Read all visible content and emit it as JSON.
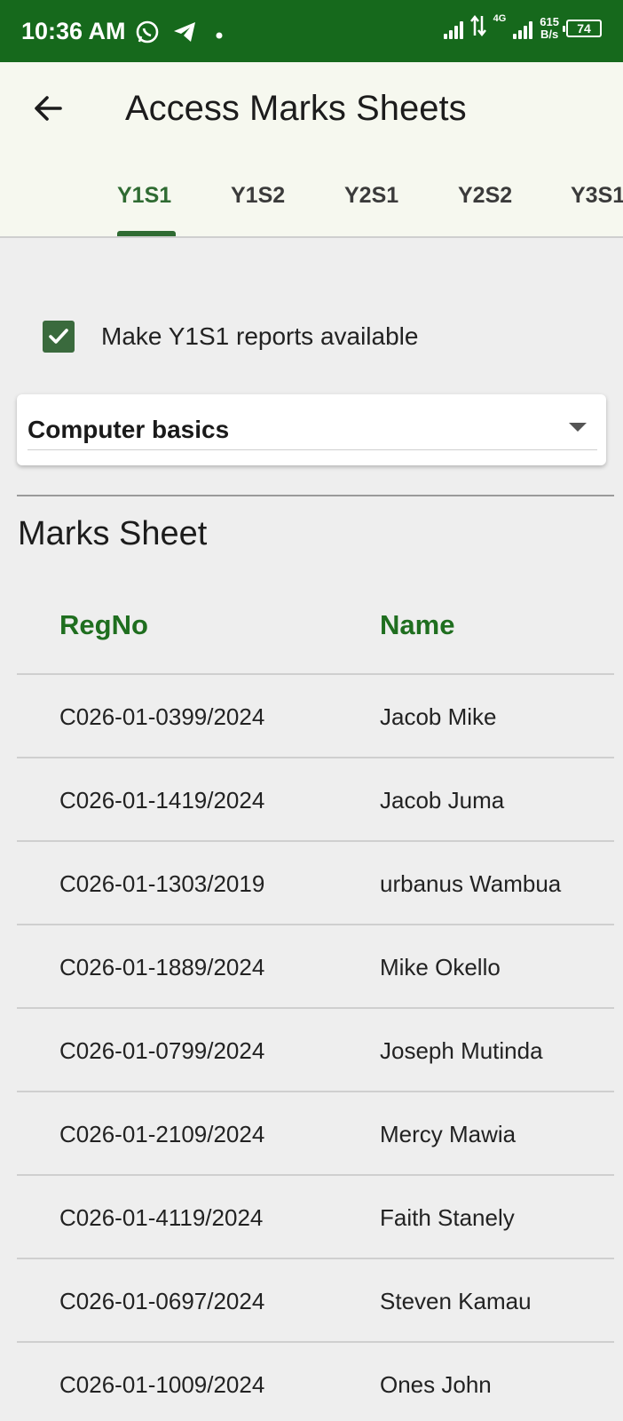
{
  "status_bar": {
    "time": "10:36 AM",
    "network_type": "4G",
    "speed_value": "615",
    "speed_unit": "B/s",
    "battery": "74"
  },
  "app_bar": {
    "title": "Access Marks Sheets",
    "back_icon": "arrow-back-icon"
  },
  "tabs": [
    {
      "label": "Y1S1",
      "active": true
    },
    {
      "label": "Y1S2",
      "active": false
    },
    {
      "label": "Y2S1",
      "active": false
    },
    {
      "label": "Y2S2",
      "active": false
    },
    {
      "label": "Y3S1",
      "active": false
    }
  ],
  "availability": {
    "label": "Make Y1S1 reports available",
    "checked": true
  },
  "course_select": {
    "value": "Computer basics"
  },
  "marks_sheet": {
    "title": "Marks Sheet",
    "columns": [
      "RegNo",
      "Name"
    ],
    "rows": [
      [
        "C026-01-0399/2024",
        "Jacob Mike"
      ],
      [
        "C026-01-1419/2024",
        "Jacob Juma"
      ],
      [
        "C026-01-1303/2019",
        "urbanus Wambua"
      ],
      [
        "C026-01-1889/2024",
        "Mike Okello"
      ],
      [
        "C026-01-0799/2024",
        "Joseph Mutinda"
      ],
      [
        "C026-01-2109/2024",
        "Mercy Mawia"
      ],
      [
        "C026-01-4119/2024",
        "Faith Stanely"
      ],
      [
        "C026-01-0697/2024",
        "Steven Kamau"
      ],
      [
        "C026-01-1009/2024",
        "Ones John"
      ]
    ]
  },
  "colors": {
    "status_bar": "#16691c",
    "accent": "#2f6b32",
    "header_text": "#1f6e1f",
    "app_bar_bg": "#f6f8ef",
    "page_bg": "#eeeeee"
  }
}
